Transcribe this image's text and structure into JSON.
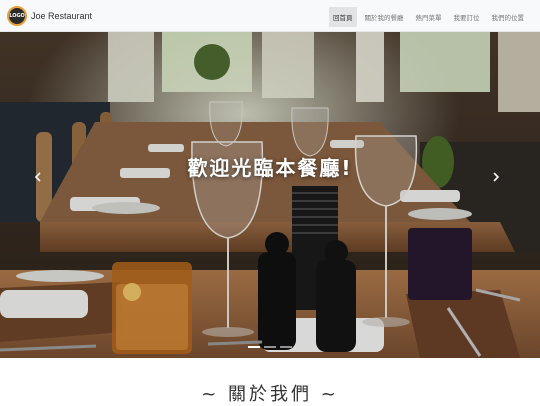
{
  "brand": {
    "logo_text": "LOGO",
    "name": "Joe Restaurant"
  },
  "nav": {
    "items": [
      {
        "label": "回首頁",
        "active": true
      },
      {
        "label": "關於我的餐廳",
        "active": false
      },
      {
        "label": "熱門菜單",
        "active": false
      },
      {
        "label": "我要訂位",
        "active": false
      },
      {
        "label": "我們的位置",
        "active": false
      }
    ]
  },
  "hero": {
    "caption": "歡迎光臨本餐廳!",
    "prev_icon": "chevron-left-icon",
    "next_icon": "chevron-right-icon",
    "slide_count": 3,
    "active_slide": 1
  },
  "about": {
    "title": "~ 關於我們 ~"
  },
  "colors": {
    "navbar_bg": "#f8f9fa",
    "active_nav_bg": "#e2e3e5",
    "logo_ring": "#e9a23b"
  }
}
